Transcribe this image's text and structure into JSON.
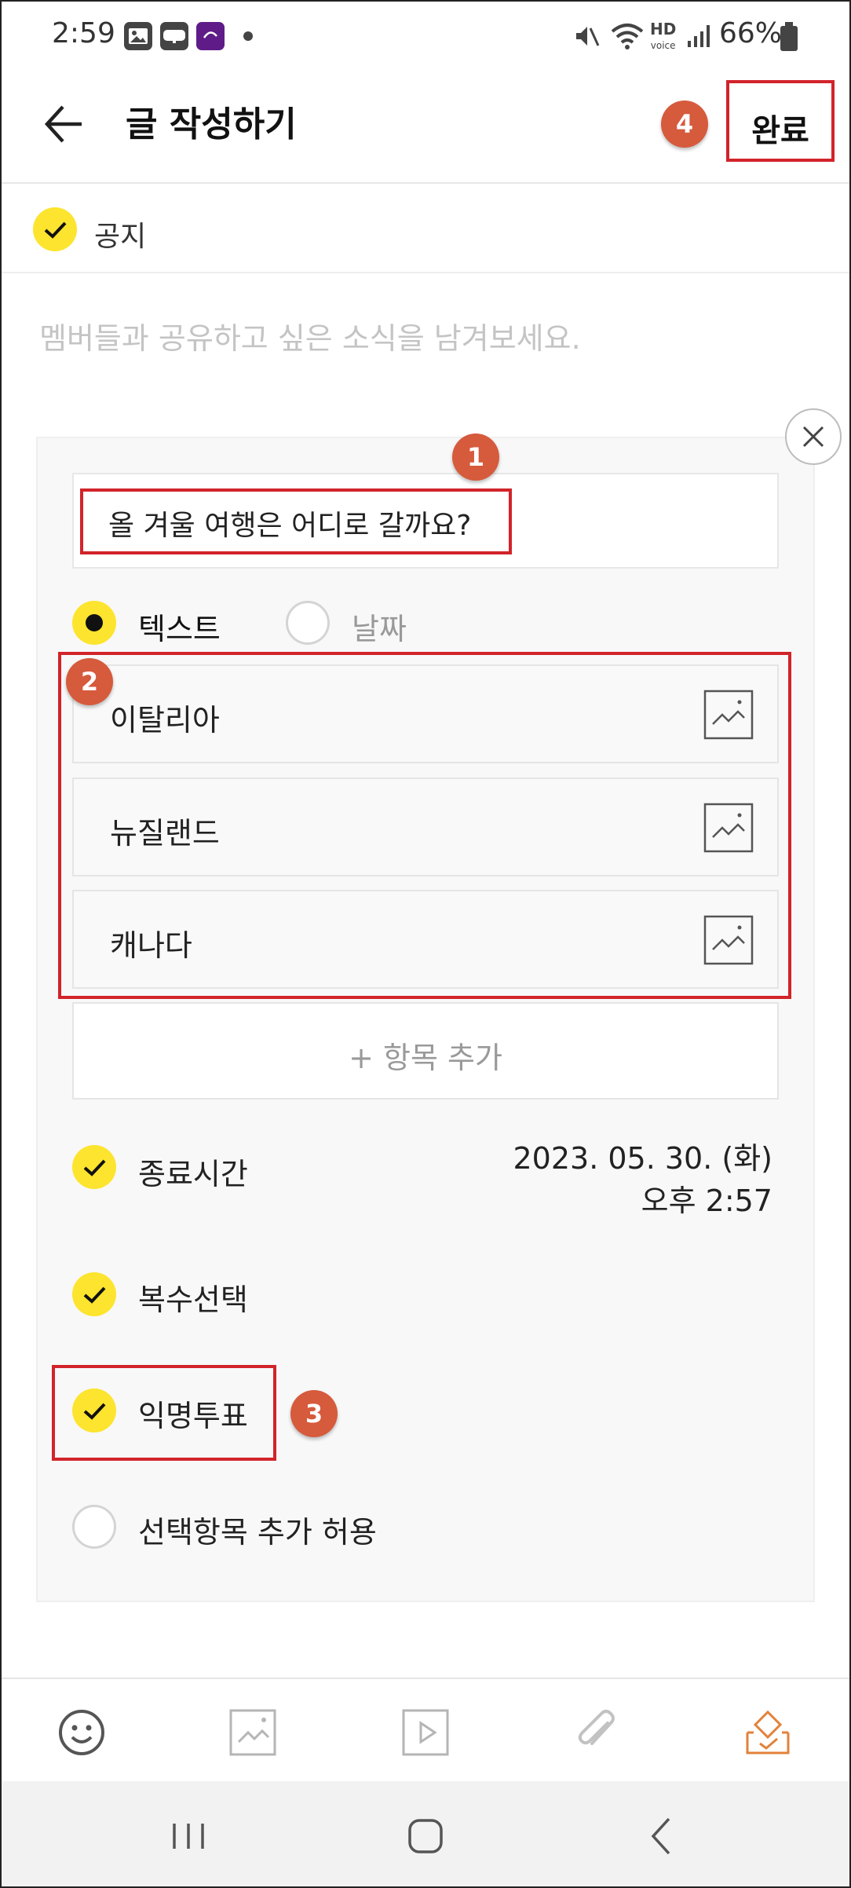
{
  "status_bar": {
    "time": "2:59",
    "app_icons": [
      "image-notification-icon",
      "blog-notification-icon",
      "kurly-notification-icon"
    ],
    "battery": "66%",
    "network_label": "HD"
  },
  "header": {
    "title": "글 작성하기",
    "done_label": "완료"
  },
  "callouts": {
    "c1": "1",
    "c2": "2",
    "c3": "3",
    "c4": "4"
  },
  "notice": {
    "label": "공지",
    "checked": true
  },
  "content": {
    "placeholder": "멤버들과 공유하고 싶은 소식을 남겨보세요."
  },
  "poll": {
    "question": "올 겨울 여행은 어디로 갈까요?",
    "type_options": [
      {
        "label": "텍스트",
        "selected": true
      },
      {
        "label": "날짜",
        "selected": false
      }
    ],
    "options": [
      {
        "label": "이탈리아"
      },
      {
        "label": "뉴질랜드"
      },
      {
        "label": "캐나다"
      }
    ],
    "add_item_label": "+ 항목 추가",
    "settings": {
      "end_time": {
        "label": "종료시간",
        "date": "2023. 05. 30. (화)",
        "time": "오후 2:57",
        "checked": true
      },
      "multiple": {
        "label": "복수선택",
        "checked": true
      },
      "anonymous": {
        "label": "익명투표",
        "checked": true
      },
      "allow_add": {
        "label": "선택항목 추가 허용",
        "checked": false
      }
    }
  },
  "toolbar": {
    "icons": [
      "emoji-icon",
      "image-icon",
      "video-icon",
      "attach-icon",
      "vote-icon"
    ],
    "accent_color": "#e2823a"
  },
  "colors": {
    "highlight": "#d2232a",
    "callout": "#d65a3c",
    "check_yellow": "#fde42e"
  }
}
